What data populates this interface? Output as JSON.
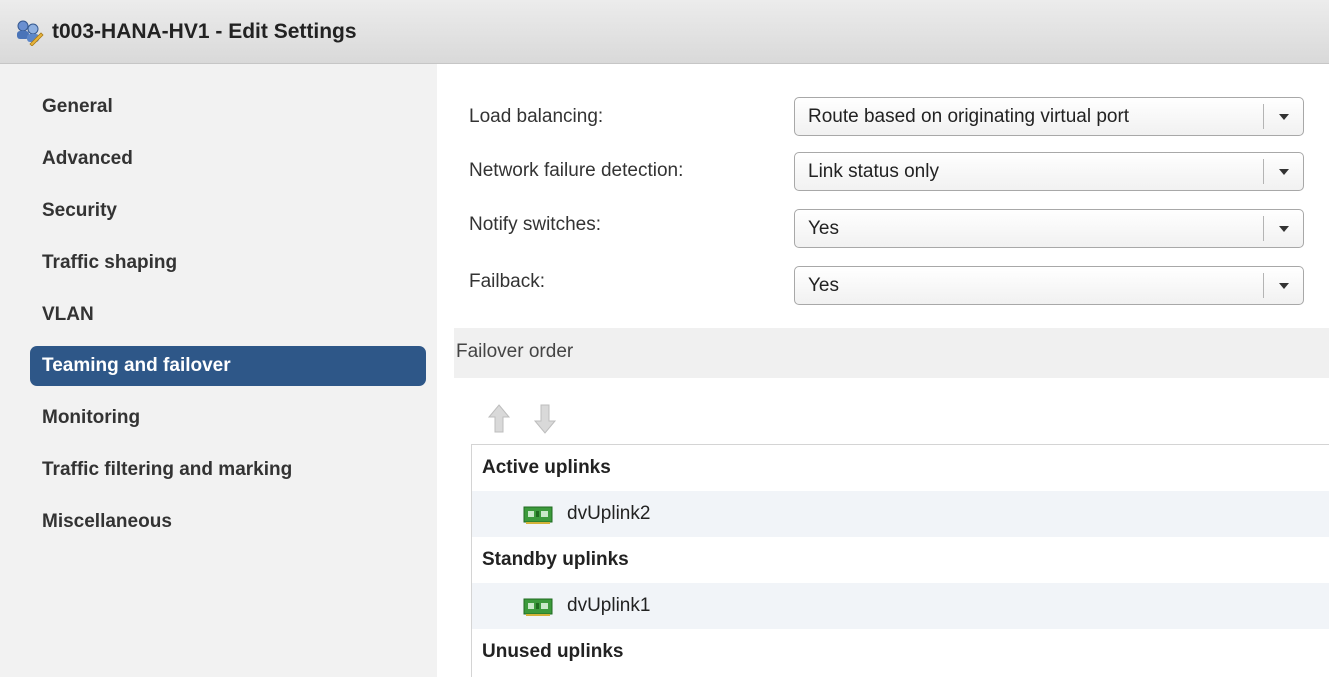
{
  "window": {
    "title": "t003-HANA-HV1 - Edit Settings",
    "icon": "network-settings-icon"
  },
  "sidebar": {
    "items": [
      {
        "label": "General"
      },
      {
        "label": "Advanced"
      },
      {
        "label": "Security"
      },
      {
        "label": "Traffic shaping"
      },
      {
        "label": "VLAN"
      },
      {
        "label": "Teaming and failover",
        "selected": true
      },
      {
        "label": "Monitoring"
      },
      {
        "label": "Traffic filtering and marking"
      },
      {
        "label": "Miscellaneous"
      }
    ]
  },
  "form": {
    "load_balancing": {
      "label": "Load balancing:",
      "value": "Route based on originating virtual port"
    },
    "network_failure_detection": {
      "label": "Network failure detection:",
      "value": "Link status only"
    },
    "notify_switches": {
      "label": "Notify switches:",
      "value": "Yes"
    },
    "failback": {
      "label": "Failback:",
      "value": "Yes"
    }
  },
  "failover_order": {
    "title": "Failover order",
    "move_up_icon": "arrow-up-icon",
    "move_down_icon": "arrow-down-icon",
    "active_header": "Active uplinks",
    "active_uplinks": [
      "dvUplink2"
    ],
    "standby_header": "Standby uplinks",
    "standby_uplinks": [
      "dvUplink1"
    ],
    "unused_header": "Unused uplinks"
  },
  "colors": {
    "selected_nav": "#2e5788",
    "sidebar_bg": "#f2f2f2",
    "uplink_row_bg": "#f1f4f8",
    "nic_icon_green": "#3c9a3c"
  }
}
